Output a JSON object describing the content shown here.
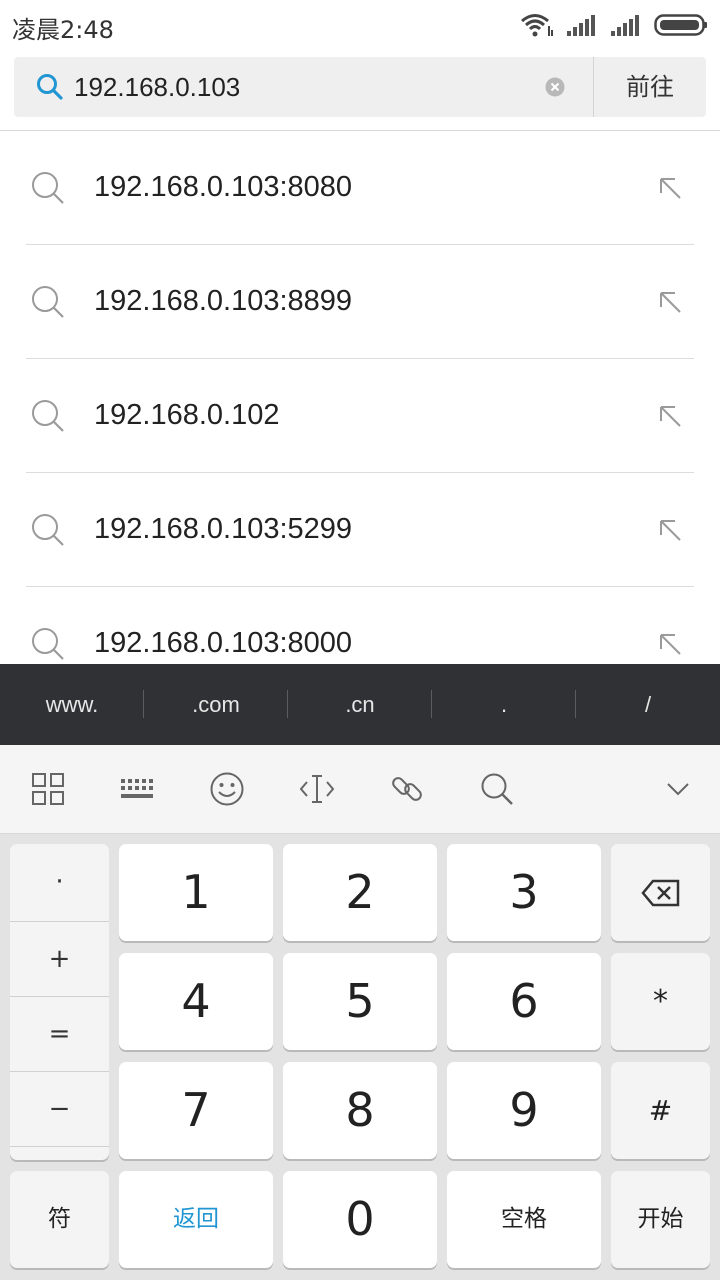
{
  "status_bar": {
    "time": "凌晨2:48"
  },
  "search": {
    "value": "192.168.0.103",
    "go_label": "前往"
  },
  "suggestions": [
    {
      "text": "192.168.0.103:8080"
    },
    {
      "text": "192.168.0.103:8899"
    },
    {
      "text": "192.168.0.102"
    },
    {
      "text": "192.168.0.103:5299"
    },
    {
      "text": "192.168.0.103:8000"
    }
  ],
  "quick_bar": [
    "www.",
    ".com",
    ".cn",
    ".",
    "/"
  ],
  "keyboard": {
    "symbols": [
      "·",
      "+",
      "=",
      "−"
    ],
    "digits": [
      "1",
      "2",
      "3",
      "4",
      "5",
      "6",
      "7",
      "8",
      "9",
      "0"
    ],
    "asterisk": "*",
    "hash": "#",
    "symbols_key": "符",
    "back_key": "返回",
    "space_key": "空格",
    "start_key": "开始"
  },
  "colors": {
    "accent": "#2196d3",
    "quick_bar_bg": "#2f3134",
    "keyboard_bg": "#e3e3e3"
  },
  "icons": [
    "wifi-icon",
    "signal-icon",
    "battery-icon",
    "search-icon",
    "clear-icon",
    "arrow-up-left-icon",
    "grid-icon",
    "keyboard-icon",
    "emoji-icon",
    "cursor-icon",
    "link-icon",
    "collapse-icon",
    "backspace-icon"
  ]
}
